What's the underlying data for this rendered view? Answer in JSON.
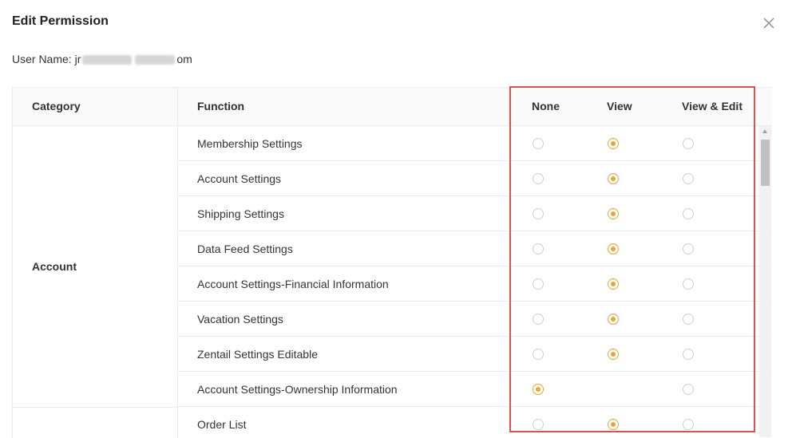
{
  "dialog": {
    "title": "Edit Permission"
  },
  "user": {
    "label": "User Name:",
    "value_start": "jr",
    "value_end": "om"
  },
  "table": {
    "headers": {
      "category": "Category",
      "function": "Function",
      "none": "None",
      "view": "View",
      "view_edit": "View & Edit"
    },
    "category": "Account",
    "rows": [
      {
        "function": "Membership Settings",
        "selected": "view",
        "options": [
          "none",
          "view",
          "view_edit"
        ]
      },
      {
        "function": "Account Settings",
        "selected": "view",
        "options": [
          "none",
          "view",
          "view_edit"
        ]
      },
      {
        "function": "Shipping Settings",
        "selected": "view",
        "options": [
          "none",
          "view",
          "view_edit"
        ]
      },
      {
        "function": "Data Feed Settings",
        "selected": "view",
        "options": [
          "none",
          "view",
          "view_edit"
        ]
      },
      {
        "function": "Account Settings-Financial Information",
        "selected": "view",
        "options": [
          "none",
          "view",
          "view_edit"
        ]
      },
      {
        "function": "Vacation Settings",
        "selected": "view",
        "options": [
          "none",
          "view",
          "view_edit"
        ]
      },
      {
        "function": "Zentail Settings Editable",
        "selected": "view",
        "options": [
          "none",
          "view",
          "view_edit"
        ]
      },
      {
        "function": "Account Settings-Ownership Information",
        "selected": "none",
        "options": [
          "none",
          "view_edit"
        ]
      },
      {
        "function": "Order List",
        "selected": "view",
        "options": [
          "none",
          "view",
          "view_edit"
        ]
      }
    ]
  },
  "colors": {
    "accent": "#f0a232",
    "highlight_border": "#d9534f",
    "header_bg": "#fafafa",
    "border": "#ececec"
  }
}
